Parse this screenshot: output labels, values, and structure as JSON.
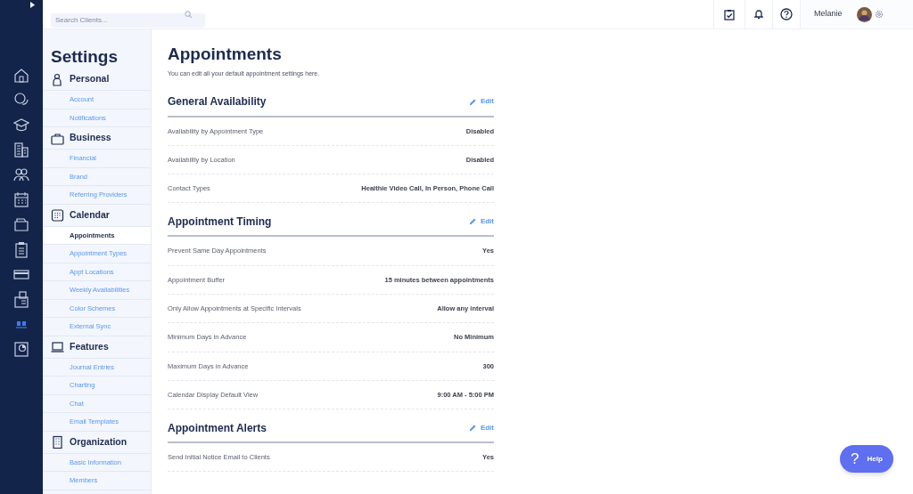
{
  "search": {
    "placeholder": "Search Clients..."
  },
  "rail": [
    {
      "kind": "home",
      "selected": false
    },
    {
      "kind": "chat",
      "selected": false
    },
    {
      "kind": "cap",
      "selected": false
    },
    {
      "kind": "building",
      "selected": false
    },
    {
      "kind": "people",
      "selected": false
    },
    {
      "kind": "calendar",
      "selected": false
    },
    {
      "kind": "folder",
      "selected": false
    },
    {
      "kind": "clipboard",
      "selected": false
    },
    {
      "kind": "card",
      "selected": false
    },
    {
      "kind": "fax",
      "selected": false
    },
    {
      "kind": "bars",
      "selected": true
    },
    {
      "kind": "report",
      "selected": false
    }
  ],
  "user": {
    "name": "Melanie"
  },
  "settings": {
    "title": "Settings",
    "groups": [
      {
        "kind": "person",
        "label": "Personal",
        "items": [
          {
            "label": "Account",
            "selected": false
          },
          {
            "label": "Notifications",
            "selected": false
          }
        ]
      },
      {
        "kind": "briefcase",
        "label": "Business",
        "items": [
          {
            "label": "Financial",
            "selected": false
          },
          {
            "label": "Brand",
            "selected": false
          },
          {
            "label": "Referring Providers",
            "selected": false
          }
        ]
      },
      {
        "kind": "calendar",
        "label": "Calendar",
        "items": [
          {
            "label": "Appointments",
            "selected": true
          },
          {
            "label": "Appointment Types",
            "selected": false
          },
          {
            "label": "Appt Locations",
            "selected": false
          },
          {
            "label": "Weekly Availabilities",
            "selected": false
          },
          {
            "label": "Color Schemes",
            "selected": false
          },
          {
            "label": "External Sync",
            "selected": false
          }
        ]
      },
      {
        "kind": "laptop",
        "label": "Features",
        "items": [
          {
            "label": "Journal Entries",
            "selected": false
          },
          {
            "label": "Charting",
            "selected": false
          },
          {
            "label": "Chat",
            "selected": false
          },
          {
            "label": "Email Templates",
            "selected": false
          }
        ]
      },
      {
        "kind": "building",
        "label": "Organization",
        "items": [
          {
            "label": "Basic Information",
            "selected": false
          },
          {
            "label": "Members",
            "selected": false
          }
        ]
      }
    ]
  },
  "page": {
    "title": "Appointments",
    "subtitle": "You can edit all your default appointment settings here.",
    "sections": [
      {
        "title": "General Availability",
        "action": "Edit",
        "rows": [
          {
            "label": "Availability by Appointment Type",
            "value": "Disabled"
          },
          {
            "label": "Availability by Location",
            "value": "Disabled"
          },
          {
            "label": "Contact Types",
            "value": "Healthie Video Call, In Person, Phone Call"
          }
        ]
      },
      {
        "title": "Appointment Timing",
        "action": "Edit",
        "rows": [
          {
            "label": "Prevent Same Day Appointments",
            "value": "Yes"
          },
          {
            "label": "Appointment Buffer",
            "value": "15 minutes between appointments"
          },
          {
            "label": "Only Allow Appointments at Specific Intervals",
            "value": "Allow any interval"
          },
          {
            "label": "Minimum Days in Advance",
            "value": "No Minimum"
          },
          {
            "label": "Maximum Days in Advance",
            "value": "300"
          },
          {
            "label": "Calendar Display Default View",
            "value": "9:00 AM - 5:00 PM"
          }
        ]
      },
      {
        "title": "Appointment Alerts",
        "action": "Edit",
        "rows": [
          {
            "label": "Send Initial Notice Email to Clients",
            "value": "Yes"
          }
        ]
      }
    ]
  },
  "help": {
    "label": "Help",
    "icon": "?"
  }
}
